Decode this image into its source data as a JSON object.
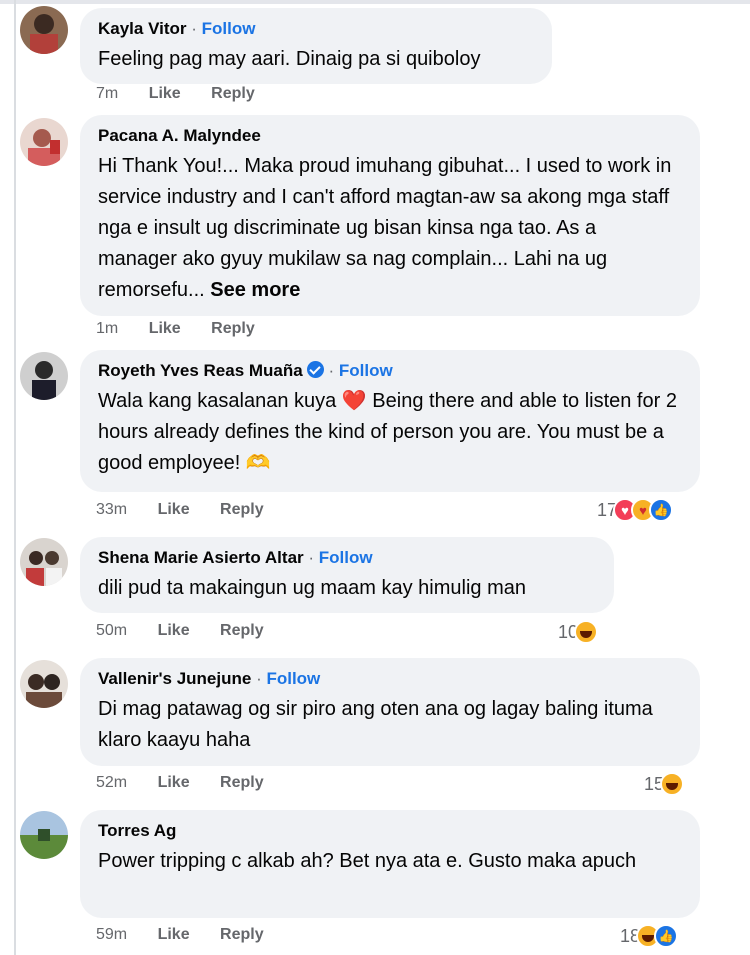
{
  "comments": [
    {
      "name": "Kayla Vitor",
      "follow": "Follow",
      "text": "Feeling pag may aari. Dinaig pa si quiboloy",
      "time": "7m",
      "like": "Like",
      "reply": "Reply"
    },
    {
      "name": "Pacana A. Malyndee",
      "text": "Hi Thank You!... Maka proud imuhang gibuhat... I used to work in service industry and I can't afford magtan-aw sa akong mga staff nga e insult ug discriminate ug bisan kinsa nga tao. As a manager ako gyuy mukilaw sa nag complain... Lahi na ug remorsefu...",
      "see_more": "See more",
      "time": "1m",
      "like": "Like",
      "reply": "Reply"
    },
    {
      "name": "Royeth Yves Reas Muaña",
      "follow": "Follow",
      "text": "Wala kang kasalanan kuya ❤️ Being there and able to listen for 2 hours already defines the kind of person you are. You must be a good employee! 🫶",
      "time": "33m",
      "like": "Like",
      "reply": "Reply",
      "reaction_count": "17"
    },
    {
      "name": "Shena Marie Asierto Altar",
      "follow": "Follow",
      "text": "dili pud ta makaingun ug maam kay himulig man",
      "time": "50m",
      "like": "Like",
      "reply": "Reply",
      "reaction_count": "10"
    },
    {
      "name": "Vallenir's Junejune",
      "follow": "Follow",
      "text": "Di mag patawag og sir piro ang oten ana og lagay baling ituma klaro kaayu haha",
      "time": "52m",
      "like": "Like",
      "reply": "Reply",
      "reaction_count": "15"
    },
    {
      "name": "Torres Ag",
      "text": "Power tripping c alkab ah? Bet nya ata e. Gusto maka apuch",
      "time": "59m",
      "like": "Like",
      "reply": "Reply",
      "reaction_count": "18"
    }
  ],
  "colors": {
    "bubble": "#f0f2f5",
    "follow": "#1b74e4",
    "meta": "#65676b"
  }
}
